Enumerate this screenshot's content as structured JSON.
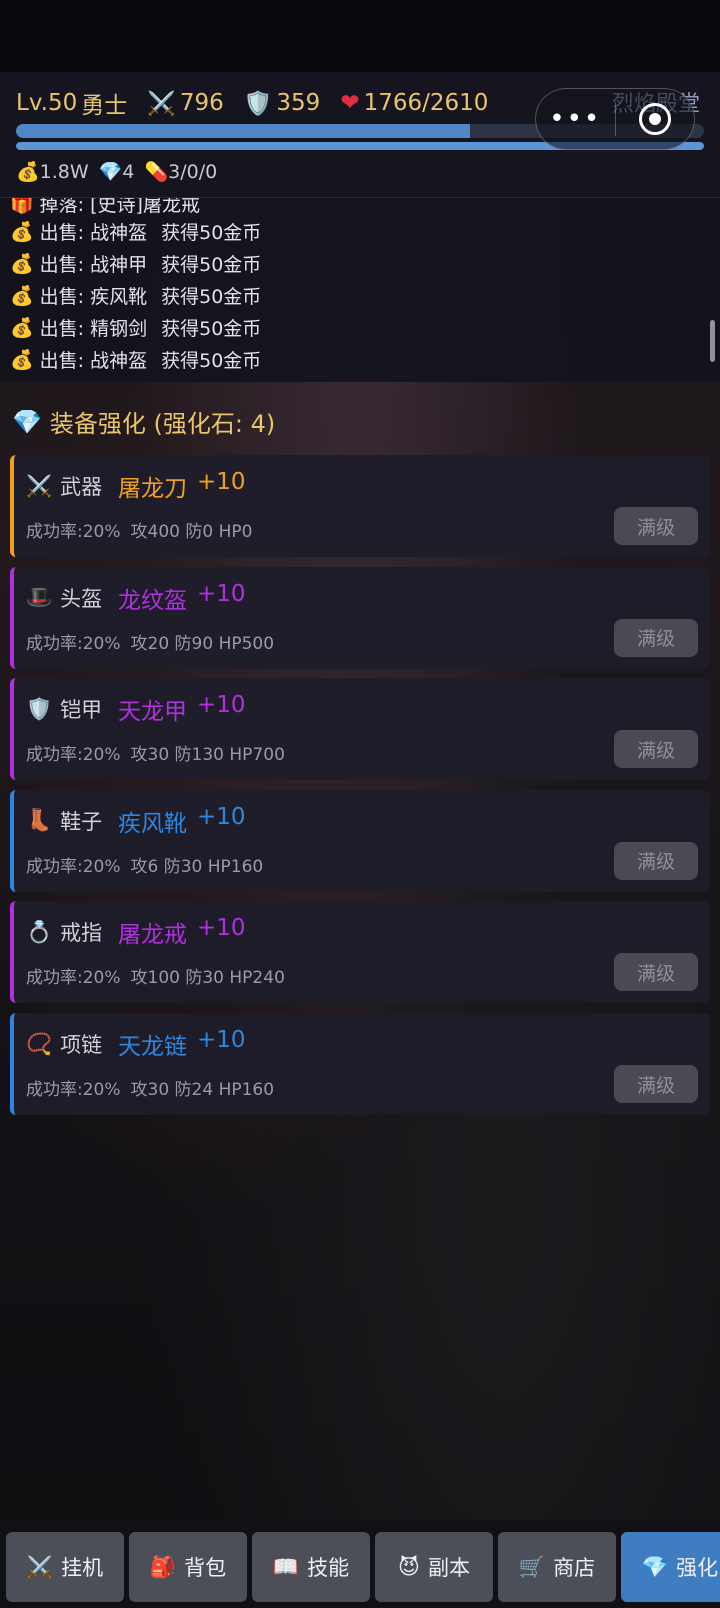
{
  "header": {
    "level_label": "Lv.50",
    "class_label": "勇士",
    "attack": "796",
    "defense": "359",
    "hp": "1766/2610",
    "game_title": "烈焰殿堂",
    "exp_fraction": 0.66,
    "bar2_fraction": 1.0,
    "gold": "1.8W",
    "diamonds": "4",
    "potions": "3/0/0"
  },
  "capsule": {
    "more_label": "•••"
  },
  "log": {
    "drop_line": "掉落: [史诗]屠龙戒",
    "lines": [
      {
        "action": "出售: 战神盔",
        "result": "获得50金币"
      },
      {
        "action": "出售: 战神甲",
        "result": "获得50金币"
      },
      {
        "action": "出售: 疾风靴",
        "result": "获得50金币"
      },
      {
        "action": "出售: 精钢剑",
        "result": "获得50金币"
      },
      {
        "action": "出售: 战神盔",
        "result": "获得50金币"
      }
    ]
  },
  "section": {
    "title": "装备强化 (强化石: 4)"
  },
  "cards": [
    {
      "slot": "武器",
      "icon": "crossed-swords",
      "item": "屠龙刀",
      "level": "+10",
      "color": "#f0a020",
      "rate": "成功率:20%",
      "stats": "攻400 防0 HP0",
      "button": "满级"
    },
    {
      "slot": "头盔",
      "icon": "top-hat",
      "item": "龙纹盔",
      "level": "+10",
      "color": "#b030e0",
      "rate": "成功率:20%",
      "stats": "攻20 防90 HP500",
      "button": "满级"
    },
    {
      "slot": "铠甲",
      "icon": "shield",
      "item": "天龙甲",
      "level": "+10",
      "color": "#b030e0",
      "rate": "成功率:20%",
      "stats": "攻30 防130 HP700",
      "button": "满级"
    },
    {
      "slot": "鞋子",
      "icon": "boot",
      "item": "疾风靴",
      "level": "+10",
      "color": "#2f86e0",
      "rate": "成功率:20%",
      "stats": "攻6 防30 HP160",
      "button": "满级"
    },
    {
      "slot": "戒指",
      "icon": "ring",
      "item": "屠龙戒",
      "level": "+10",
      "color": "#b030e0",
      "rate": "成功率:20%",
      "stats": "攻100 防30 HP240",
      "button": "满级"
    },
    {
      "slot": "项链",
      "icon": "necklace",
      "item": "天龙链",
      "level": "+10",
      "color": "#2f86e0",
      "rate": "成功率:20%",
      "stats": "攻30 防24 HP160",
      "button": "满级"
    }
  ],
  "nav": [
    {
      "label": "挂机",
      "icon": "crossed-swords",
      "active": false
    },
    {
      "label": "背包",
      "icon": "backpack",
      "active": false
    },
    {
      "label": "技能",
      "icon": "book",
      "active": false
    },
    {
      "label": "副本",
      "icon": "devil",
      "active": false
    },
    {
      "label": "商店",
      "icon": "cart",
      "active": false
    },
    {
      "label": "强化",
      "icon": "gem",
      "active": true
    }
  ]
}
